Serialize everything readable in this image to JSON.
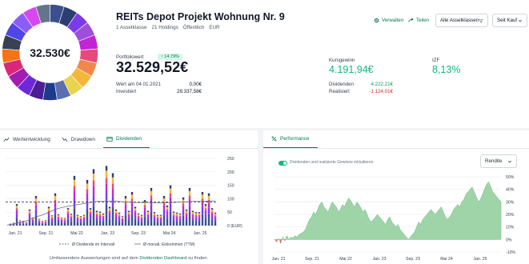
{
  "portfolio": {
    "donut_total": "32.530€",
    "title": "REITs Depot Projekt Wohnung Nr. 9",
    "meta": [
      "1 Assetklasse",
      "21 Holdings",
      "Öffentlich",
      "EUR"
    ],
    "allocation_colors": [
      "#3b4f8f",
      "#2d3e73",
      "#7c3aed",
      "#9d4edd",
      "#c026d3",
      "#e54a7a",
      "#f0884c",
      "#f4b73a",
      "#e8d44d",
      "#5b6fb0",
      "#1e3a8a",
      "#4c1d95",
      "#6d28d9",
      "#a21caf",
      "#db2777",
      "#f97316",
      "#374151",
      "#4f46e5",
      "#8b5cf6",
      "#d946ef",
      "#64748b"
    ]
  },
  "actions": {
    "manage": "Verwalten",
    "share": "Teilen",
    "asset_classes": "Alle Assetklassen",
    "since": "Seit Kauf"
  },
  "stats": {
    "portfolio_label": "Portfoliowert",
    "portfolio_change": "↑ 14.79%",
    "portfolio_value": "32.529,52€",
    "value_at_label": "Wert am 04.01.2021",
    "value_at": "0,00€",
    "invested_label": "Investiert",
    "invested": "28.337,58€",
    "gain_label": "Kursgewinn",
    "gain": "4.191,94€",
    "izf_label": "IZF",
    "izf": "8,13%",
    "dividends_label": "Dividenden",
    "dividends": "4.222,21€",
    "realized_label": "Realisiert",
    "realized": "-1.124,01€"
  },
  "left_panel": {
    "tabs": [
      "Wertentwicklung",
      "Drawdown",
      "Dividenden"
    ],
    "active_tab": "Dividenden",
    "legend_interval": "Ø Dividende im Intervall",
    "legend_monthly": "Ø monatl. Einkommen (TTM)",
    "footer_prefix": "Umfassendere Auswertungen sind auf dem",
    "footer_link": "Dividenden Dashboard",
    "footer_suffix": "zu finden."
  },
  "right_panel": {
    "tab": "Performance",
    "toggle_label": "Dividenden und realisierte Gewinne inkludieren",
    "select": "Rendite"
  },
  "chart_data": [
    {
      "type": "bar",
      "title": "Dividenden",
      "x_ticks": [
        "Jan. 21",
        "Sep. 21",
        "Mai 22",
        "Jan. 23",
        "Sep. 23",
        "Mai 24",
        "Jan. 25"
      ],
      "y_ticks": [
        "250",
        "200",
        "150",
        "100",
        "50",
        "0 (EUR)"
      ],
      "ylim": [
        0,
        250
      ],
      "values": [
        0,
        8,
        12,
        80,
        20,
        18,
        14,
        60,
        30,
        110,
        25,
        18,
        20,
        70,
        38,
        120,
        42,
        30,
        28,
        65,
        44,
        185,
        40,
        35,
        40,
        170,
        65,
        210,
        55,
        52,
        45,
        222,
        70,
        195,
        60,
        48,
        35,
        110,
        55,
        125,
        70,
        45,
        40,
        95,
        55,
        140,
        50,
        40,
        40,
        110,
        75,
        150,
        52,
        48,
        45,
        105,
        60,
        140,
        55,
        50,
        50,
        125,
        80,
        120,
        65,
        48
      ],
      "avg_interval": 88,
      "avg_monthly": [
        2,
        4,
        6,
        9,
        12,
        15,
        18,
        22,
        27,
        32,
        36,
        40,
        44,
        50,
        55,
        60,
        64,
        67,
        70,
        72,
        74,
        76,
        78,
        80,
        82,
        84,
        86,
        88,
        90,
        90,
        90,
        90,
        92,
        92,
        92,
        90,
        89,
        88,
        88,
        86,
        86,
        86,
        86,
        86,
        86,
        85,
        84,
        84,
        84,
        84,
        85,
        86,
        86,
        87,
        88,
        88,
        88,
        89,
        90,
        90,
        90,
        90,
        91,
        91,
        92,
        92
      ],
      "segment_colors": [
        "#3b4f8f",
        "#7c3aed",
        "#c026d3",
        "#e54a7a",
        "#f4b73a",
        "#2d3e73"
      ]
    },
    {
      "type": "area",
      "title": "Performance",
      "x_ticks": [
        "Jan. 21",
        "Sep. 21",
        "Mai 22",
        "Jan. 23",
        "Sep. 23",
        "Mai 24",
        "Jan. 25"
      ],
      "y_ticks": [
        "50%",
        "40%",
        "30%",
        "20%",
        "10%",
        "0%",
        "-10%"
      ],
      "ylim": [
        -10,
        50
      ],
      "values": [
        0,
        -2,
        1,
        -3,
        2,
        -1,
        3,
        0,
        2,
        1,
        3,
        2,
        4,
        5,
        6,
        8,
        12,
        16,
        18,
        22,
        20,
        24,
        28,
        30,
        26,
        24,
        22,
        26,
        30,
        28,
        26,
        22,
        24,
        28,
        26,
        30,
        33,
        31,
        28,
        26,
        30,
        28,
        25,
        22,
        24,
        20,
        16,
        14,
        16,
        18,
        20,
        18,
        16,
        14,
        12,
        16,
        18,
        14,
        12,
        10,
        12,
        8,
        6,
        4,
        2,
        0,
        2,
        4,
        6,
        10,
        14,
        12,
        16,
        18,
        20,
        22,
        24,
        22,
        20,
        22,
        24,
        26,
        22,
        18,
        16,
        18,
        20,
        24,
        26,
        28,
        26,
        30,
        32,
        36,
        38,
        40,
        42,
        38,
        34,
        30,
        32,
        36,
        40,
        44,
        46,
        42,
        38,
        36,
        34,
        32,
        30
      ]
    }
  ]
}
